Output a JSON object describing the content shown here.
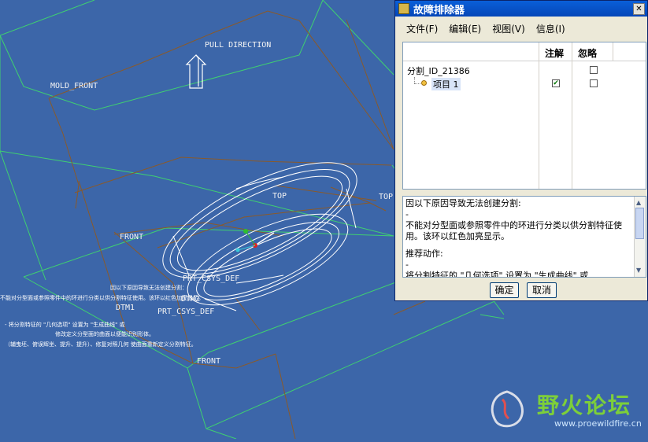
{
  "viewport": {
    "pull_direction_label": "PULL DIRECTION",
    "labels": {
      "mold_front": "MOLD_FRONT",
      "front_upper": "FRONT",
      "front_lower": "FRONT",
      "top_right": "TOP",
      "top_mid": "TOP",
      "prt_csys_1": "PRT_CSYS_DEF",
      "prt_csys_2": "PRT_CSYS_DEF",
      "dtm": "DTM1",
      "dtm2": "DTM2"
    },
    "overlay_text": [
      "因以下原因导致无法创建分割：",
      "不能对分型面或参照零件中的环进行分类以供分割特征使用。该环以红色加亮显示。",
      "-    将分割特征的 \"几何选项\" 设置为 \"生成曲线\" 或",
      "        修改定义分型面的曲面以便能识别形体。",
      "（辅曳坯、俯误辉坐、提升、提升）、修复对照几何  使曲面重新定义分割特征。"
    ]
  },
  "dialog": {
    "title": "故障排除器",
    "close_glyph": "✕",
    "menu": [
      "文件(F)",
      "编辑(E)",
      "视图(V)",
      "信息(I)"
    ],
    "columns": {
      "note": "注解",
      "ignore": "忽略"
    },
    "tree": {
      "root": "分割_ID_21386",
      "item": "项目 1",
      "item_checked": "✔"
    },
    "message": {
      "line1": "因以下原因导致无法创建分割:",
      "dash1": "-",
      "body": "不能对分型面或参照零件中的环进行分类以供分割特征使用。该环以红色加亮显示。",
      "action_title": "推荐动作:",
      "dash2": "-",
      "action": "将分割特征的 \"几何选项\" 设置为 \"生成曲线\" 或"
    },
    "buttons": {
      "ok": "确定",
      "cancel": "取消"
    }
  },
  "watermark": {
    "brand": "野火论坛",
    "url": "www.proewildfire.cn"
  },
  "colors": {
    "background": "#3c66a9",
    "green_edges": "#3fd070",
    "brown_edges": "#8a5a2a",
    "part_outline": "#ffffff"
  }
}
